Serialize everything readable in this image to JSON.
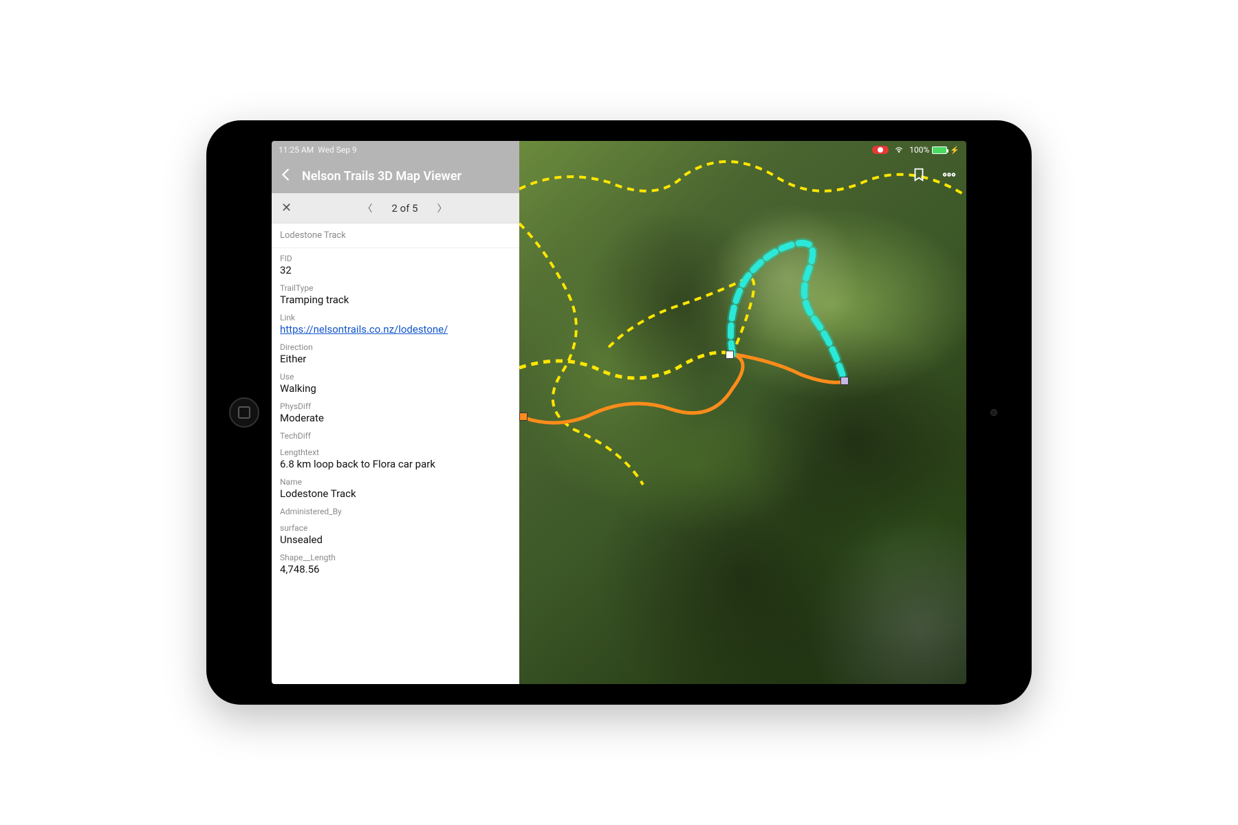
{
  "statusbar": {
    "time": "11:25 AM",
    "date": "Wed Sep 9",
    "battery": "100%"
  },
  "header": {
    "title": "Nelson Trails 3D Map Viewer"
  },
  "pager": {
    "text": "2 of 5"
  },
  "feature": {
    "subtitle": "Lodestone Track",
    "fields": {
      "fid_label": "FID",
      "fid_value": "32",
      "trailtype_label": "TrailType",
      "trailtype_value": "Tramping track",
      "link_label": "Link",
      "link_value": "https://nelsontrails.co.nz/lodestone/",
      "direction_label": "Direction",
      "direction_value": "Either",
      "use_label": "Use",
      "use_value": "Walking",
      "physdiff_label": "PhysDiff",
      "physdiff_value": "Moderate",
      "techdiff_label": "TechDiff",
      "techdiff_value": "",
      "lengthtext_label": "Lengthtext",
      "lengthtext_value": "6.8 km loop back to Flora car park",
      "name_label": "Name",
      "name_value": "Lodestone Track",
      "admin_label": "Administered_By",
      "admin_value": "",
      "surface_label": "surface",
      "surface_value": "Unsealed",
      "shapelen_label": "Shape__Length",
      "shapelen_value": "4,748.56"
    }
  }
}
